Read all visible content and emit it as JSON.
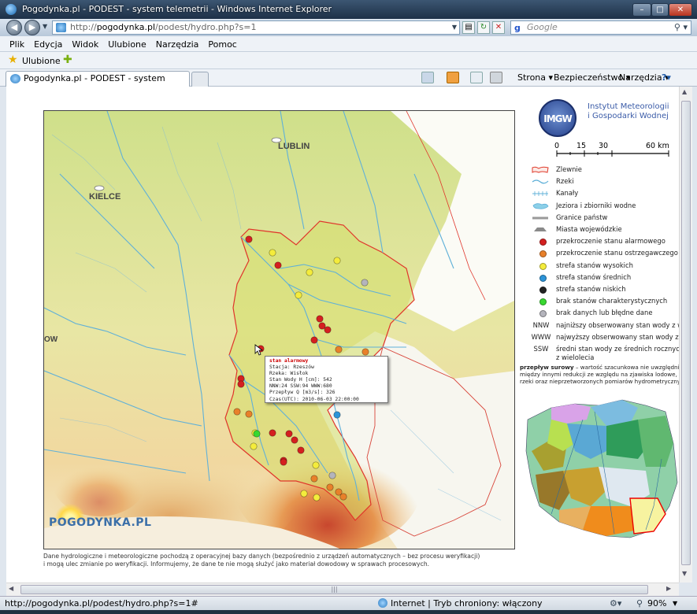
{
  "window": {
    "title": "Pogodynka.pl - PODEST - system telemetrii - Windows Internet Explorer",
    "min": "–",
    "max": "□",
    "close": "✕"
  },
  "address": {
    "prefix": "http://",
    "host": "pogodynka.pl",
    "path": "/podest/hydro.php?s=1",
    "search_engine": "Google",
    "search_placeholder": "Google"
  },
  "menu": [
    "Plik",
    "Edycja",
    "Widok",
    "Ulubione",
    "Narzędzia",
    "Pomoc"
  ],
  "favorites": {
    "label": "Ulubione"
  },
  "tab": {
    "title": "Pogodynka.pl - PODEST - system telemetrii"
  },
  "commands": {
    "strona": "Strona ▾",
    "bezp": "Bezpieczeństwo ▾",
    "narz": "Narzędzia ▾",
    "help": "?▾"
  },
  "map": {
    "cities": [
      "LUBLIN",
      "KIELCE",
      "OW"
    ],
    "logo": "POGODYNKA.PL",
    "popup": {
      "heading": "stan alarmowy",
      "stacja": "Stacja: Rzeszów",
      "rzeka": "Rzeka: Wisłok",
      "stan": "Stan Wody H [cm]: 542",
      "nnw": "NNW:24 SSW:94 WWW:680",
      "przeplyw": "Przepływ Q [m3/s]: 326",
      "czas": "Czas(UTC): 2010-06-03 22:00:00"
    }
  },
  "footer": {
    "line1": "Dane hydrologiczne i meteorologiczne pochodzą z operacyjnej bazy danych (bezpośrednio z urządzeń automatycznych – bez procesu weryfikacji)",
    "line2": "i mogą ulec zmianie po weryfikacji. Informujemy, że dane te nie mogą służyć jako materiał dowodowy w sprawach procesowych."
  },
  "legend": {
    "inst_line1": "Instytut Meteorologii",
    "inst_line2": "i Gospodarki Wodnej",
    "inst_logo": "IMGW",
    "scale": [
      "0",
      "15",
      "30",
      "60 km"
    ],
    "items": [
      {
        "label": "Zlewnie",
        "kind": "basin"
      },
      {
        "label": "Rzeki",
        "kind": "river"
      },
      {
        "label": "Kanały",
        "kind": "canal"
      },
      {
        "label": "Jeziora i zbiorniki wodne",
        "kind": "lake"
      },
      {
        "label": "Granice państw",
        "kind": "border"
      },
      {
        "label": "Miasta wojewódzkie",
        "kind": "city"
      },
      {
        "label": "przekroczenie stanu alarmowego",
        "kind": "dot",
        "color": "#d42020"
      },
      {
        "label": "przekroczenie stanu ostrzegawczego",
        "kind": "dot",
        "color": "#e8802a"
      },
      {
        "label": "strefa stanów wysokich",
        "kind": "dot",
        "color": "#f4ec3c"
      },
      {
        "label": "strefa stanów średnich",
        "kind": "dot",
        "color": "#2c94d8"
      },
      {
        "label": "strefa stanów niskich",
        "kind": "dot",
        "color": "#222222"
      },
      {
        "label": "brak stanów charakterystycznych",
        "kind": "dot",
        "color": "#38d830"
      },
      {
        "label": "brak danych lub błędne dane",
        "kind": "dot",
        "color": "#b4b4bc"
      }
    ],
    "abbr": [
      {
        "code": "NNW",
        "label": "najniższy obserwowany stan wody z wie"
      },
      {
        "code": "WWW",
        "label": "najwyższy obserwowany stan wody z wie"
      },
      {
        "code": "SSW",
        "label": "średni stan wody ze średnich rocznych",
        "label2": "z wielolecia"
      }
    ],
    "flow_bold": "przepływ surowy",
    "flow_rest": " – wartość szacunkowa nie uwzględniają",
    "flow_line2": "między innymi redukcji ze względu na zjawiska lodowe, zac",
    "flow_line3": "rzeki oraz nieprzetworzonych pomiarów hydrometrycznyc"
  },
  "status": {
    "url": "http://pogodynka.pl/podest/hydro.php?s=1#",
    "zone": "Internet | Tryb chroniony: włączony",
    "zoom": "90%"
  },
  "colors": {
    "alarm": "#d42020",
    "warn": "#e8802a",
    "high": "#f4ec3c",
    "mid": "#2c94d8",
    "low": "#222222",
    "none": "#38d830",
    "nodata": "#b4b4bc"
  }
}
